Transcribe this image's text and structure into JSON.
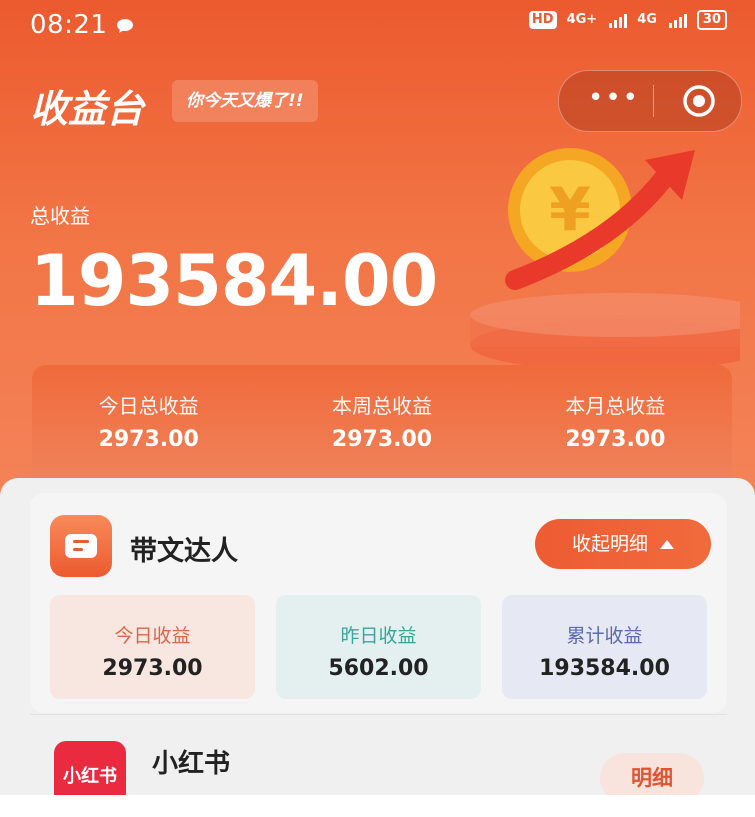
{
  "status": {
    "time": "08:21",
    "hd": "HD",
    "net1": "4G+",
    "net2": "4G",
    "battery": "30"
  },
  "header": {
    "title": "收益台",
    "tagline": "你今天又爆了!!",
    "more_label": "•••"
  },
  "total": {
    "label": "总收益",
    "value": "193584.00"
  },
  "summary": [
    {
      "label": "今日总收益",
      "value": "2973.00"
    },
    {
      "label": "本周总收益",
      "value": "2973.00"
    },
    {
      "label": "本月总收益",
      "value": "2973.00"
    }
  ],
  "card": {
    "title": "带文达人",
    "collapse_label": "收起明细",
    "stats": [
      {
        "label": "今日收益",
        "value": "2973.00"
      },
      {
        "label": "昨日收益",
        "value": "5602.00"
      },
      {
        "label": "累计收益",
        "value": "193584.00"
      }
    ]
  },
  "platform": {
    "logo_text": "小红书",
    "name": "小红书",
    "detail_label": "明细"
  },
  "colors": {
    "primary": "#ec5a2f",
    "xhs": "#ea2b3f"
  }
}
